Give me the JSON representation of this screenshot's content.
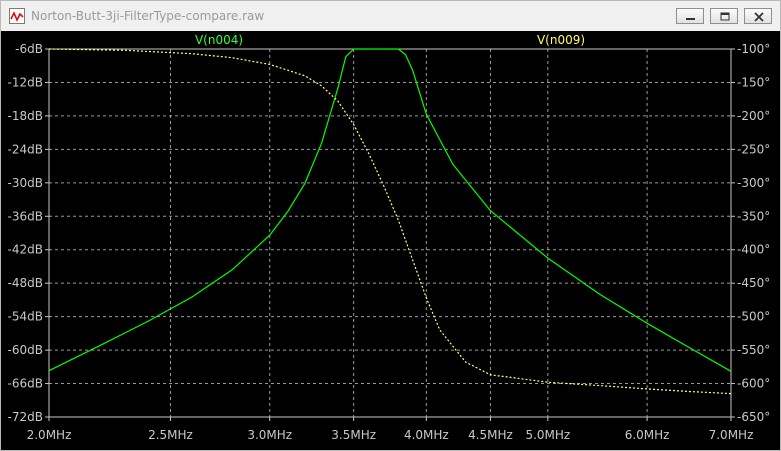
{
  "window": {
    "title": "Norton-Butt-3ji-FilterType-compare.raw"
  },
  "chart_data": {
    "type": "line",
    "x_scale": "log",
    "x_ticks": [
      "2.0MHz",
      "2.5MHz",
      "3.0MHz",
      "3.5MHz",
      "4.0MHz",
      "4.5MHz",
      "5.0MHz",
      "6.0MHz",
      "7.0MHz"
    ],
    "x_tick_values": [
      2.0,
      2.5,
      3.0,
      3.5,
      4.0,
      4.5,
      5.0,
      6.0,
      7.0
    ],
    "xlim": [
      2.0,
      7.0
    ],
    "left_ticks": [
      "-6dB",
      "-12dB",
      "-18dB",
      "-24dB",
      "-30dB",
      "-36dB",
      "-42dB",
      "-48dB",
      "-54dB",
      "-60dB",
      "-66dB",
      "-72dB"
    ],
    "left_tick_values": [
      -6,
      -12,
      -18,
      -24,
      -30,
      -36,
      -42,
      -48,
      -54,
      -60,
      -66,
      -72
    ],
    "ylim_left": [
      -72,
      -6
    ],
    "right_ticks": [
      "-100°",
      "-150°",
      "-200°",
      "-250°",
      "-300°",
      "-350°",
      "-400°",
      "-450°",
      "-500°",
      "-550°",
      "-600°",
      "-650°"
    ],
    "right_tick_values": [
      -100,
      -150,
      -200,
      -250,
      -300,
      -350,
      -400,
      -450,
      -500,
      -550,
      -600,
      -650
    ],
    "ylim_right": [
      -650,
      -100
    ],
    "grid": true,
    "series": [
      {
        "name": "V(n004)",
        "color": "#00ff00",
        "label_color": "#33ff33",
        "axis": "left",
        "style": "solid",
        "x": [
          2.0,
          2.2,
          2.4,
          2.6,
          2.8,
          3.0,
          3.1,
          3.2,
          3.3,
          3.4,
          3.45,
          3.5,
          3.6,
          3.7,
          3.8,
          3.85,
          3.9,
          4.0,
          4.2,
          4.5,
          5.0,
          5.5,
          6.0,
          6.5,
          7.0
        ],
        "values": [
          -63.7,
          -59.1,
          -54.8,
          -50.5,
          -45.6,
          -39.4,
          -35.2,
          -30.1,
          -22.9,
          -13.0,
          -7.4,
          -6.0,
          -6.0,
          -6.0,
          -6.0,
          -7.0,
          -9.8,
          -17.7,
          -26.7,
          -35.0,
          -43.5,
          -50.0,
          -55.2,
          -59.7,
          -63.8
        ]
      },
      {
        "name": "V(n009)",
        "color": "#ffff80",
        "label_color": "#ffff66",
        "axis": "right",
        "style": "dashed",
        "x": [
          2.0,
          2.3,
          2.6,
          2.8,
          3.0,
          3.2,
          3.3,
          3.4,
          3.5,
          3.6,
          3.7,
          3.8,
          3.9,
          4.0,
          4.1,
          4.3,
          4.5,
          5.0,
          5.5,
          6.0,
          6.5,
          7.0
        ],
        "values": [
          -100,
          -102,
          -107,
          -113,
          -123,
          -140,
          -155,
          -178,
          -213,
          -257,
          -305,
          -356,
          -415,
          -472,
          -520,
          -568,
          -587,
          -598,
          -603,
          -608,
          -612,
          -615
        ]
      }
    ]
  }
}
